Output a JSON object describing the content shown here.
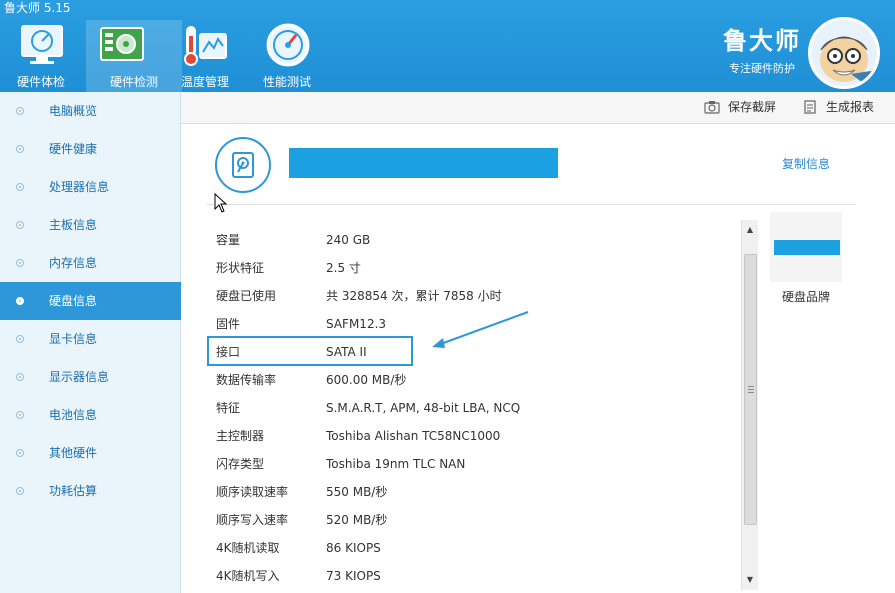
{
  "app": {
    "title": "鲁大师 5.15"
  },
  "nav": {
    "tabs": [
      {
        "label": "硬件体检",
        "icon": "monitor-icon"
      },
      {
        "label": "硬件检测",
        "icon": "circuit-board-icon"
      },
      {
        "label": "温度管理",
        "icon": "thermometer-icon"
      },
      {
        "label": "性能测试",
        "icon": "speedometer-icon"
      }
    ],
    "active": "硬件检测"
  },
  "brand": {
    "name": "鲁大师",
    "slogan": "专注硬件防护"
  },
  "sidebar": {
    "items": [
      {
        "label": "电脑概览"
      },
      {
        "label": "硬件健康"
      },
      {
        "label": "处理器信息"
      },
      {
        "label": "主板信息"
      },
      {
        "label": "内存信息"
      },
      {
        "label": "硬盘信息"
      },
      {
        "label": "显卡信息"
      },
      {
        "label": "显示器信息"
      },
      {
        "label": "电池信息"
      },
      {
        "label": "其他硬件"
      },
      {
        "label": "功耗估算"
      }
    ],
    "active": "硬盘信息"
  },
  "toolbar": {
    "screenshot_label": "保存截屏",
    "report_label": "生成报表"
  },
  "disk": {
    "copy_label": "复制信息",
    "specs": [
      {
        "key": "容量",
        "value": "240 GB"
      },
      {
        "key": "形状特征",
        "value": "2.5 寸"
      },
      {
        "key": "硬盘已使用",
        "value": "共 328854 次，累计 7858 小时"
      },
      {
        "key": "固件",
        "value": "SAFM12.3"
      },
      {
        "key": "接口",
        "value": "SATA II"
      },
      {
        "key": "数据传输率",
        "value": "600.00 MB/秒"
      },
      {
        "key": "特征",
        "value": "S.M.A.R.T, APM, 48-bit LBA, NCQ"
      },
      {
        "key": "主控制器",
        "value": "Toshiba Alishan TC58NC1000"
      },
      {
        "key": "闪存类型",
        "value": "Toshiba 19nm TLC NAN"
      },
      {
        "key": "顺序读取速率",
        "value": "550 MB/秒"
      },
      {
        "key": "顺序写入速率",
        "value": "520 MB/秒"
      },
      {
        "key": "4K随机读取",
        "value": "86 KIOPS"
      },
      {
        "key": "4K随机写入",
        "value": "73 KIOPS"
      }
    ],
    "brand_label": "硬盘品牌"
  },
  "colors": {
    "accent": "#2d97d9",
    "redaction": "#1ba1e2",
    "header": "#2a9ee0"
  }
}
